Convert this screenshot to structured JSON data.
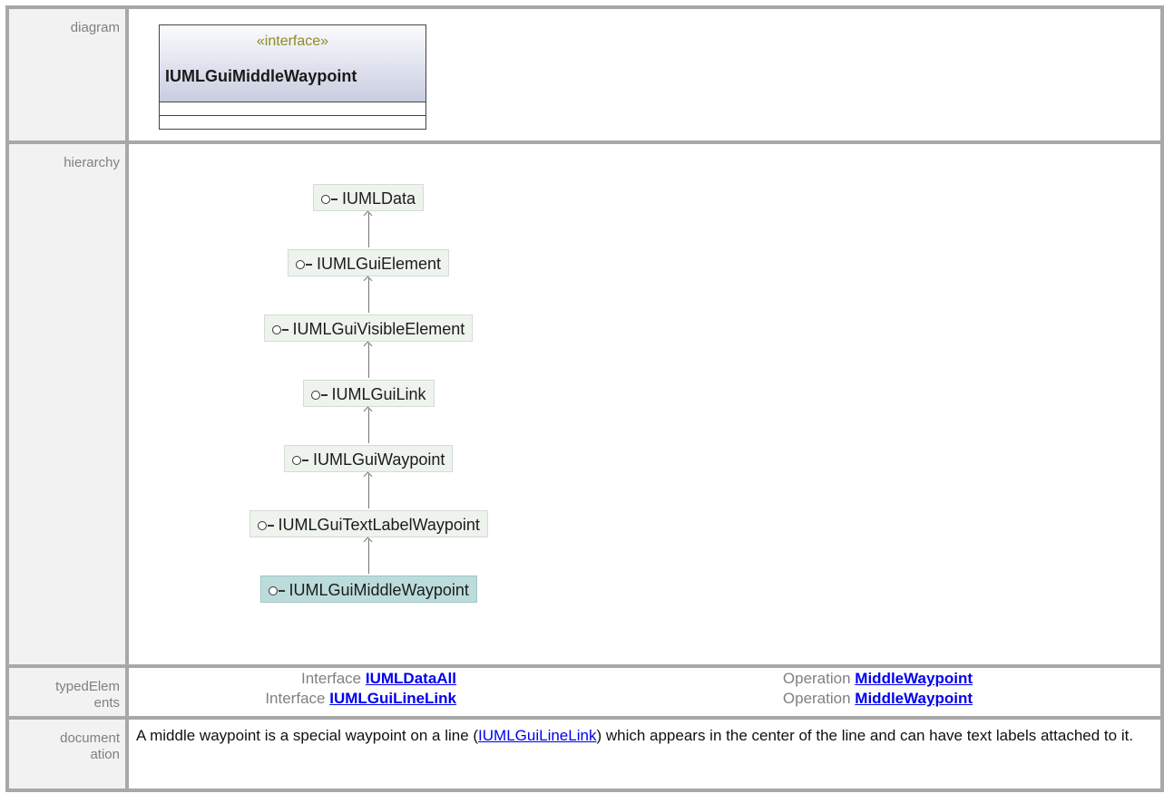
{
  "labels": {
    "diagram": "diagram",
    "hierarchy": "hierarchy",
    "typed_elements_1": "typedElem",
    "typed_elements_2": "ents",
    "documentation_1": "document",
    "documentation_2": "ation"
  },
  "diagram": {
    "stereotype": "«interface»",
    "name": "IUMLGuiMiddleWaypoint"
  },
  "hierarchy": [
    "IUMLData",
    "IUMLGuiElement",
    "IUMLGuiVisibleElement",
    "IUMLGuiLink",
    "IUMLGuiWaypoint",
    "IUMLGuiTextLabelWaypoint",
    "IUMLGuiMiddleWaypoint"
  ],
  "typed_elements": [
    {
      "kind": "Interface",
      "name": "IUMLDataAll",
      "op_kind": "Operation",
      "op_name": "MiddleWaypoint"
    },
    {
      "kind": "Interface",
      "name": "IUMLGuiLineLink",
      "op_kind": "Operation",
      "op_name": "MiddleWaypoint"
    }
  ],
  "documentation": {
    "before": "A middle waypoint is a special waypoint on a line (",
    "link": "IUMLGuiLineLink",
    "after": ") which appears in the center of the line and can have text labels attached to it."
  },
  "icons": {
    "interface": "interface-lollipop-icon"
  }
}
